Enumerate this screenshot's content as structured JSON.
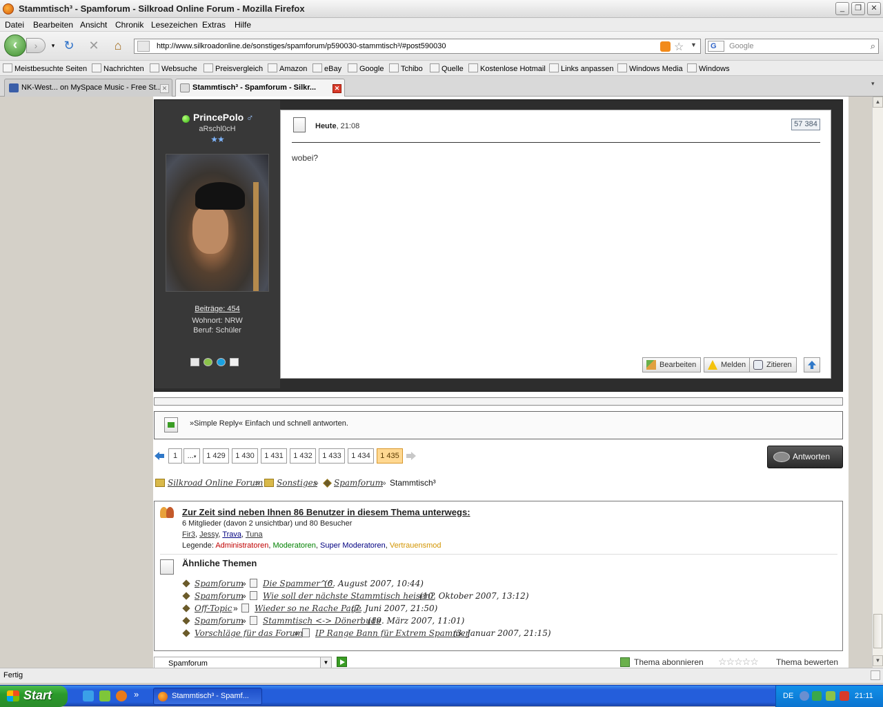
{
  "window": {
    "title": "Stammtisch³ - Spamforum - Silkroad Online Forum - Mozilla Firefox",
    "minimize": "_",
    "maximize": "❐",
    "close": "✕"
  },
  "menu": [
    "Datei",
    "Bearbeiten",
    "Ansicht",
    "Chronik",
    "Lesezeichen",
    "Extras",
    "Hilfe"
  ],
  "nav": {
    "url": "http://www.silkroadonline.de/sonstiges/spamforum/p590030-stammtisch³/#post590030",
    "search_placeholder": "Google",
    "search_engine": "G"
  },
  "bookmarks": [
    "Meistbesuchte Seiten",
    "Nachrichten",
    "Websuche",
    "Preisvergleich",
    "Amazon",
    "eBay",
    "Google",
    "Tchibo",
    "Quelle",
    "Kostenlose Hotmail",
    "Links anpassen",
    "Windows Media",
    "Windows"
  ],
  "tabs": [
    {
      "label": "NK-West... on MySpace Music - Free St...",
      "active": false
    },
    {
      "label": "Stammtisch³ - Spamforum - Silkr...",
      "active": true
    }
  ],
  "post": {
    "username": "PrincePolo",
    "gender_symbol": "♂",
    "user_title": "aRschl0cH",
    "rank_stars": "★★",
    "posts_label": "Beiträge: 454",
    "location": "Wohnort: NRW",
    "occupation": "Beruf: Schüler",
    "date_bold": "Heute",
    "date_rest": ", 21:08",
    "post_number": "57 384",
    "text": "wobei?",
    "buttons": {
      "edit": "Bearbeiten",
      "report": "Melden",
      "quote": "Zitieren"
    }
  },
  "quick_reply": "»Simple Reply« Einfach und schnell antworten.",
  "pagination": {
    "pages": [
      "1",
      "...",
      "1 429",
      "1 430",
      "1 431",
      "1 432",
      "1 433",
      "1 434",
      "1 435"
    ],
    "active": "1 435",
    "reply_button": "Antworten"
  },
  "breadcrumb": {
    "items": [
      "Silkroad Online Forum",
      "Sonstiges",
      "Spamforum"
    ],
    "current": "Stammtisch³",
    "separator": "»"
  },
  "online": {
    "headline": "Zur Zeit sind neben Ihnen 86 Benutzer in diesem Thema unterwegs:",
    "summary": "6 Mitglieder (davon 2 unsichtbar) und 80 Besucher",
    "members": [
      "Fir3",
      "Jessy",
      "Trava",
      "Tuna"
    ],
    "legend_label": "Legende:",
    "legend": {
      "admin": "Administratoren",
      "mod": "Moderatoren",
      "smod": "Super Moderatoren",
      "vmod": "Vertrauensmod"
    }
  },
  "similar": {
    "title": "Ähnliche Themen",
    "items": [
      {
        "forum": "Spamforum",
        "thread": "Die Spammer^^",
        "date": "(6. August 2007, 10:44)"
      },
      {
        "forum": "Spamforum",
        "thread": "Wie soll der nächste Stammtisch heisen?",
        "date": "(10. Oktober 2007, 13:12)"
      },
      {
        "forum": "Off-Topic",
        "thread": "Wieder so ne Rache Page",
        "date": "(7. Juni 2007, 21:50)"
      },
      {
        "forum": "Spamforum",
        "thread": "Stammtisch <-> Dönerbude",
        "date": "(19. März 2007, 11:01)"
      },
      {
        "forum": "Vorschläge für das Forum",
        "thread": "IP Range Bann für Extrem Spammer",
        "date": "(3. Januar 2007, 21:15)"
      }
    ]
  },
  "bottom": {
    "forum_select": "Spamforum",
    "subscribe": "Thema abonnieren",
    "rating_stars": "☆☆☆☆☆",
    "rate": "Thema bewerten"
  },
  "status": "Fertig",
  "taskbar": {
    "start": "Start",
    "task": "Stammtisch³ - Spamf...",
    "lang": "DE",
    "clock": "21:11",
    "more": "»"
  },
  "colors": {
    "active_page": "#ffd891",
    "admin": "#c00000",
    "mod": "#008000",
    "smod": "#000080",
    "vmod": "#d29400"
  }
}
